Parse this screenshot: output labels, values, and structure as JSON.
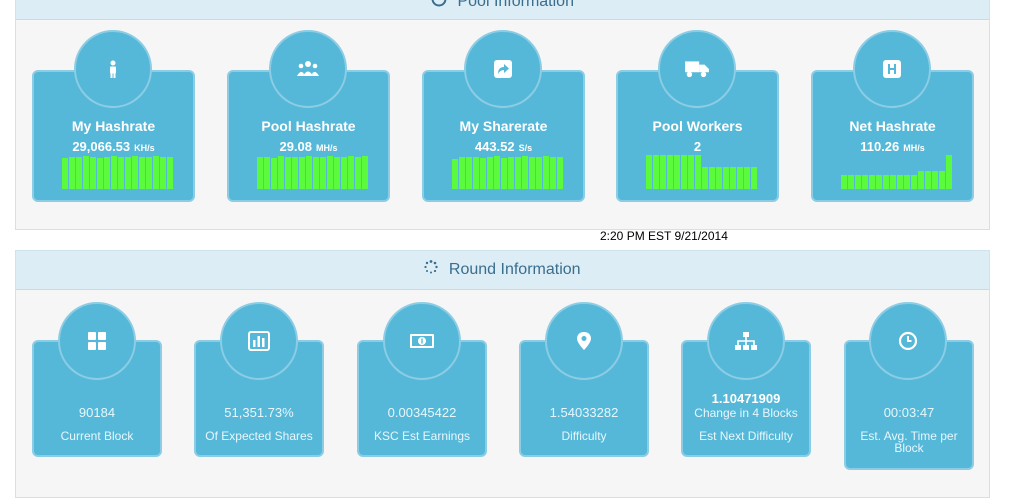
{
  "pool_panel": {
    "title": "Pool Information",
    "icon": "gauge-icon",
    "cards": [
      {
        "label": "My Hashrate",
        "value": "29,066.53",
        "unit": "KH/s",
        "icon": "user-icon",
        "bars": [
          0.85,
          0.9,
          0.88,
          0.92,
          0.9,
          0.87,
          0.9,
          0.92,
          0.88,
          0.9,
          0.91,
          0.89,
          0.9,
          0.92,
          0.88,
          0.9
        ]
      },
      {
        "label": "Pool Hashrate",
        "value": "29.08",
        "unit": "MH/s",
        "icon": "users-icon",
        "bars": [
          0.88,
          0.9,
          0.87,
          0.91,
          0.9,
          0.88,
          0.9,
          0.92,
          0.89,
          0.9,
          0.91,
          0.88,
          0.9,
          0.92,
          0.89,
          0.93
        ]
      },
      {
        "label": "My Sharerate",
        "value": "443.52",
        "unit": "S/s",
        "icon": "share-icon",
        "bars": [
          0.82,
          0.9,
          0.88,
          0.9,
          0.86,
          0.9,
          0.92,
          0.87,
          0.9,
          0.88,
          0.91,
          0.89,
          0.9,
          0.92,
          0.88,
          0.9
        ]
      },
      {
        "label": "Pool Workers",
        "value": "2",
        "unit": "",
        "icon": "truck-icon",
        "bars": [
          0.95,
          0.95,
          0.95,
          0.95,
          0.95,
          0.95,
          0.95,
          0.95,
          0.62,
          0.62,
          0.62,
          0.62,
          0.62,
          0.62,
          0.62,
          0.62
        ]
      },
      {
        "label": "Net Hashrate",
        "value": "110.26",
        "unit": "MH/s",
        "icon": "hospital-icon",
        "bars": [
          0.38,
          0.38,
          0.38,
          0.38,
          0.38,
          0.38,
          0.38,
          0.38,
          0.38,
          0.38,
          0.38,
          0.5,
          0.5,
          0.5,
          0.5,
          0.95
        ]
      }
    ]
  },
  "timestamp": "2:20 PM EST 9/21/2014",
  "round_panel": {
    "title": "Round Information",
    "icon": "spinner-icon",
    "cards": [
      {
        "value": "90184",
        "label": "Current Block",
        "icon": "grid-icon"
      },
      {
        "value": "51,351.73%",
        "label": "Of Expected Shares",
        "icon": "bar-chart-icon"
      },
      {
        "value": "0.00345422",
        "label": "KSC Est Earnings",
        "icon": "money-icon"
      },
      {
        "value": "1.54033282",
        "label": "Difficulty",
        "icon": "map-marker-icon"
      },
      {
        "value": "1.10471909",
        "sub": "Change in 4 Blocks",
        "label": "Est Next Difficulty",
        "icon": "sitemap-icon"
      },
      {
        "value": "00:03:47",
        "label": "Est. Avg. Time per Block",
        "icon": "clock-icon"
      }
    ]
  }
}
